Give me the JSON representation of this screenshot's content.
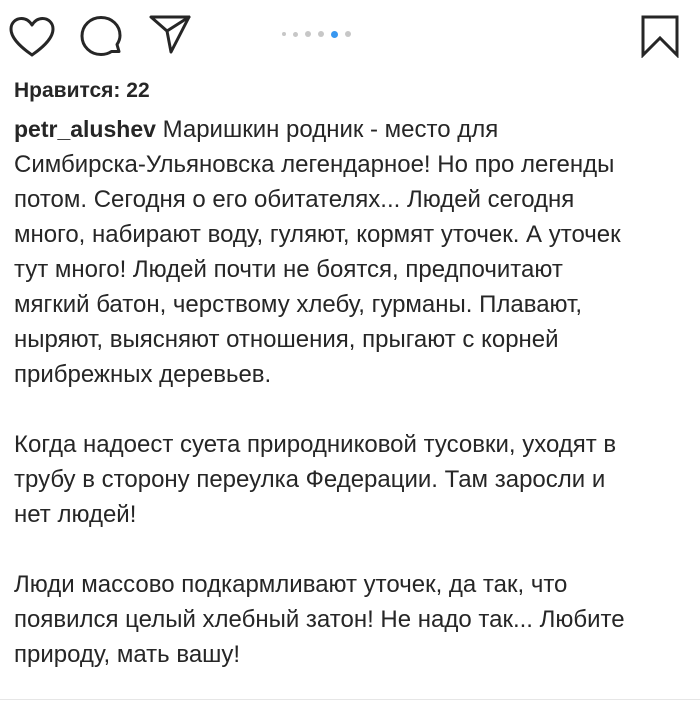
{
  "post": {
    "carousel": {
      "count": 6,
      "active_index": 4
    },
    "likes_text": "Нравится: 22",
    "username": "petr_alushev",
    "caption_first_line": "Маришкин родник - место для",
    "caption_lines": [
      "Симбирска-Ульяновска легендарное! Но про легенды",
      "потом. Сегодня о его обитателях... Людей сегодня",
      "много, набирают воду, гуляют, кормят уточек. А уточек",
      "тут много! Людей почти не боятся, предпочитают",
      "мягкий батон, черствому хлебу, гурманы. Плавают,",
      "ныряют, выясняют отношения, прыгают с корней",
      "прибрежных деревьев."
    ],
    "paragraph_2_lines": [
      "Когда надоест суета природниковой тусовки, уходят в",
      "трубу в сторону переулка Федерации. Там заросли и",
      "нет людей!"
    ],
    "paragraph_3_lines": [
      "Люди массово подкармливают уточек, да так, что",
      "появился целый хлебный затон! Не надо так... Любите",
      "природу, мать вашу!"
    ]
  },
  "icons": {
    "like": "heart-outline",
    "comment": "speech-bubble-outline",
    "share": "paper-plane-outline",
    "save": "bookmark-outline"
  },
  "colors": {
    "text": "#262626",
    "dot_inactive": "#c7c7c7",
    "dot_active": "#3897f0"
  }
}
